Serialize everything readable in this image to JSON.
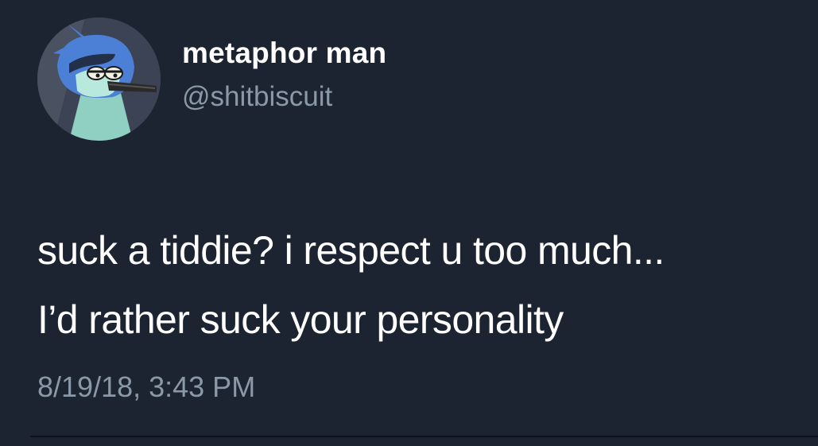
{
  "user": {
    "display_name": "metaphor man",
    "handle": "@shitbiscuit",
    "avatar_icon": "cartoon-bird-avatar"
  },
  "tweet": {
    "lines": [
      "suck a tiddie? i respect u too much...",
      "I’d rather suck your personality"
    ],
    "timestamp": "8/19/18, 3:43 PM"
  },
  "colors": {
    "background": "#1c2431",
    "primary_text": "#ffffff",
    "secondary_text": "#8b98a8"
  }
}
